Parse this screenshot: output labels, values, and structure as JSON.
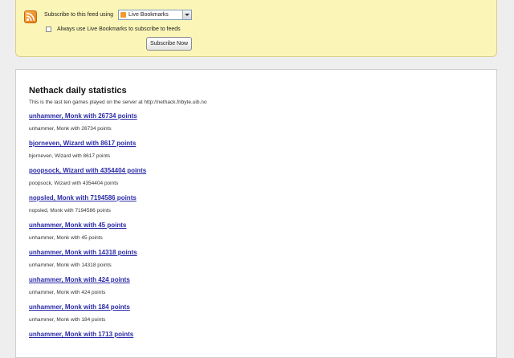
{
  "subscribe": {
    "label": "Subscribe to this feed using",
    "select_value": "Live Bookmarks",
    "checkbox_label": "Always use Live Bookmarks to subscribe to feeds",
    "checkbox_checked": false,
    "button_label": "Subscribe Now",
    "accent_color": "#fbf6b7"
  },
  "feed": {
    "title": "Nethack daily statistics",
    "description": "This is the last ten games played on the server at http://nethack.fribyte.uib.no",
    "link_color": "#2b2ba8",
    "entries": [
      {
        "title": "unhammer, Monk with 26734 points",
        "text": "unhammer, Monk with 26734 points"
      },
      {
        "title": "bjorneven, Wizard with 8617 points",
        "text": "bjorneven, Wizard with 8617 points"
      },
      {
        "title": "poopsock, Wizard with 4354404 points",
        "text": "poopsock, Wizard with 4354404 points"
      },
      {
        "title": "nopsled, Monk with 7194586 points",
        "text": "nopsled, Monk with 7194586 points"
      },
      {
        "title": "unhammer, Monk with 45 points",
        "text": "unhammer, Monk with 45 points"
      },
      {
        "title": "unhammer, Monk with 14318 points",
        "text": "unhammer, Monk with 14318 points"
      },
      {
        "title": "unhammer, Monk with 424 points",
        "text": "unhammer, Monk with 424 points"
      },
      {
        "title": "unhammer, Monk with 184 points",
        "text": "unhammer, Monk with 184 points"
      },
      {
        "title": "unhammer, Monk with 1713 points",
        "text": ""
      }
    ]
  }
}
